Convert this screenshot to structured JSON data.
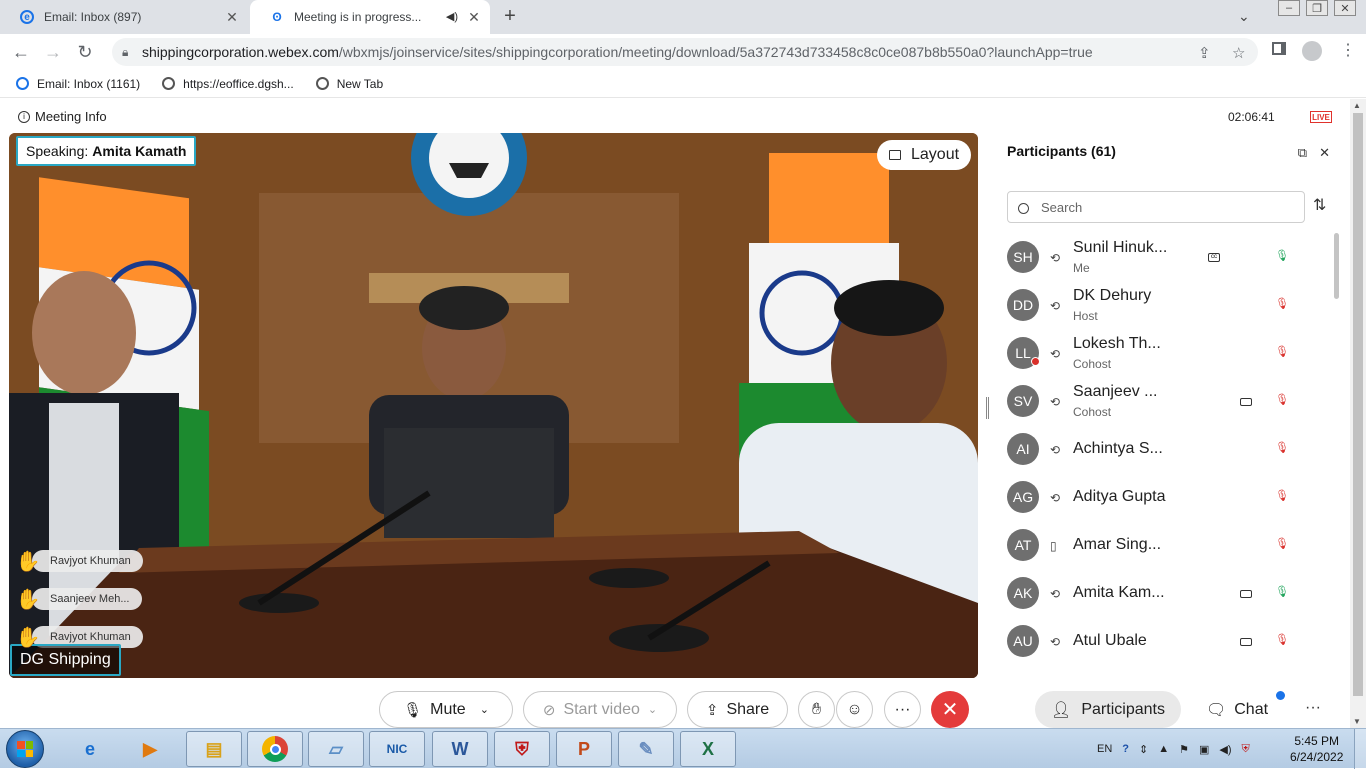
{
  "browser": {
    "tabs": [
      {
        "title": "Email: Inbox (897)",
        "active": false
      },
      {
        "title": "Meeting is in progress...",
        "active": true
      }
    ],
    "url_host": "shippingcorporation.webex.com",
    "url_path": "/wbxmjs/joinservice/sites/shippingcorporation/meeting/download/5a372743d733458c8c0ce087b8b550a0?launchApp=true",
    "bookmarks": [
      "Email: Inbox (1161)",
      "https://eoffice.dgsh...",
      "New Tab"
    ]
  },
  "meeting": {
    "info_label": "Meeting Info",
    "timer": "02:06:41",
    "live_badge": "LIVE",
    "speaking_prefix": "Speaking:",
    "speaking_name": "Amita Kamath",
    "layout_label": "Layout",
    "raised_hands": [
      "Ravjyot Khuman",
      "Saanjeev Meh...",
      "Ravjyot Khuman"
    ],
    "video_name": "DG Shipping"
  },
  "participants": {
    "title": "Participants (61)",
    "search_placeholder": "Search",
    "items": [
      {
        "initials": "SH",
        "name": "Sunil Hinuk...",
        "role": "Me",
        "mic": "on"
      },
      {
        "initials": "DD",
        "name": "DK Dehury",
        "role": "Host",
        "mic": "muted"
      },
      {
        "initials": "LL",
        "name": "Lokesh Th...",
        "role": "Cohost",
        "mic": "muted"
      },
      {
        "initials": "SV",
        "name": "Saanjeev ...",
        "role": "Cohost",
        "mic": "muted"
      },
      {
        "initials": "AI",
        "name": "Achintya S...",
        "role": "",
        "mic": "muted"
      },
      {
        "initials": "AG",
        "name": "Aditya Gupta",
        "role": "",
        "mic": "muted"
      },
      {
        "initials": "AT",
        "name": "Amar Sing...",
        "role": "",
        "mic": "muted"
      },
      {
        "initials": "AK",
        "name": "Amita Kam...",
        "role": "",
        "mic": "on"
      },
      {
        "initials": "AU",
        "name": "Atul Ubale",
        "role": "",
        "mic": "muted"
      }
    ]
  },
  "controls": {
    "mute": "Mute",
    "start_video": "Start video",
    "share": "Share",
    "participants": "Participants",
    "chat": "Chat"
  },
  "taskbar": {
    "lang": "EN",
    "time": "5:45 PM",
    "date": "6/24/2022"
  },
  "colors": {
    "accent": "#2aa8c4",
    "end_call": "#e43b3b",
    "muted_mic": "#d9302b",
    "active_mic": "#1fa35a"
  }
}
